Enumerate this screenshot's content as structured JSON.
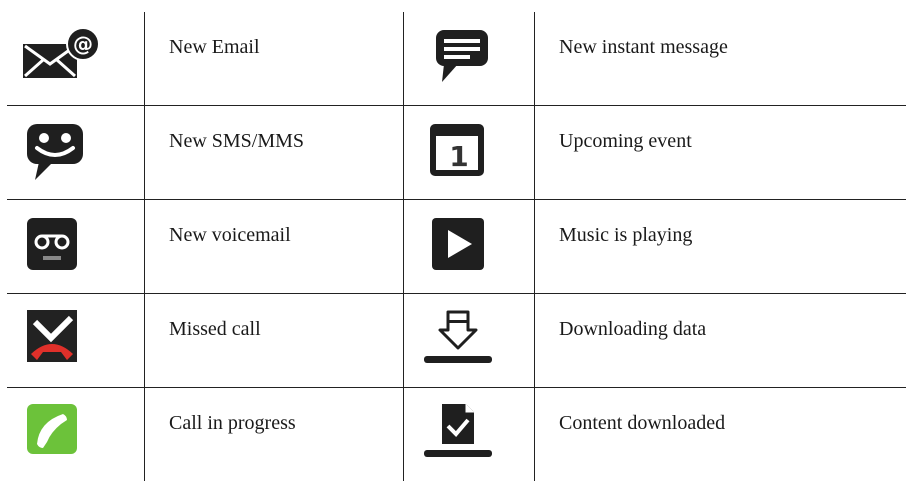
{
  "rows": [
    {
      "left": {
        "icon": "email-at-icon",
        "label": "New Email"
      },
      "right": {
        "icon": "chat-bubble-icon",
        "label": "New instant message"
      }
    },
    {
      "left": {
        "icon": "smiley-sms-icon",
        "label": "New SMS/MMS"
      },
      "right": {
        "icon": "calendar-icon",
        "label": "Upcoming event"
      }
    },
    {
      "left": {
        "icon": "voicemail-icon",
        "label": "New voicemail"
      },
      "right": {
        "icon": "play-icon",
        "label": "Music is playing"
      }
    },
    {
      "left": {
        "icon": "missed-call-icon",
        "label": "Missed call"
      },
      "right": {
        "icon": "download-icon",
        "label": "Downloading data"
      }
    },
    {
      "left": {
        "icon": "call-in-progress-icon",
        "label": "Call in progress"
      },
      "right": {
        "icon": "content-downloaded-icon",
        "label": "Content downloaded"
      }
    }
  ],
  "colors": {
    "border": "#222222",
    "icon_dark": "#1f1f1f",
    "missed_red": "#e0302a",
    "call_green": "#6cc23a"
  }
}
